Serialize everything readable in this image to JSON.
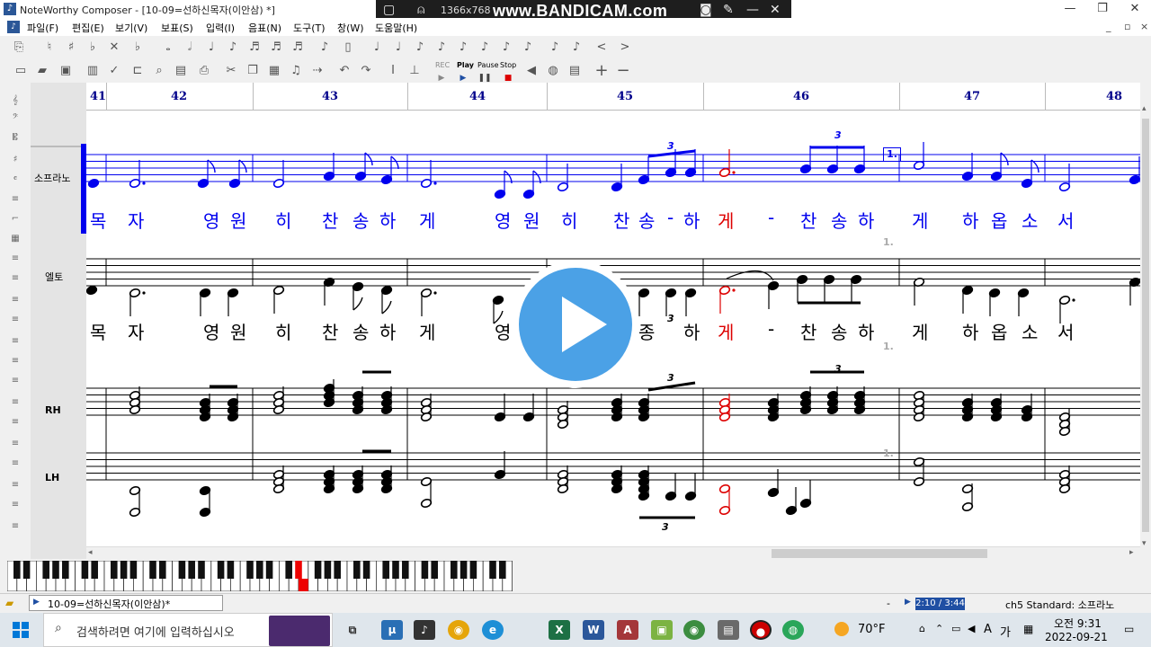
{
  "window": {
    "title": "NoteWorthy Composer - [10-09=선하신목자(이안삼) *]",
    "minimize": "—",
    "restore": "❐",
    "close": "✕",
    "mdi_min": "_",
    "mdi_restore": "▫",
    "mdi_close": "×"
  },
  "overlay": {
    "recording_size": "1366x768",
    "brand": "www.BANDICAM.com"
  },
  "menu": [
    "파일(F)",
    "편집(E)",
    "보기(V)",
    "보표(S)",
    "입력(I)",
    "음표(N)",
    "도구(T)",
    "창(W)",
    "도움말(H)"
  ],
  "toolbar2": {
    "play": "Play",
    "pause": "Pause",
    "stop": "Stop",
    "rec": "REC"
  },
  "score": {
    "measures": [
      "41",
      "42",
      "43",
      "44",
      "45",
      "46",
      "47",
      "48"
    ],
    "ending_mark": "1.",
    "tuplet": "3",
    "staves": {
      "soprano": "소프라노",
      "alto": "엘토",
      "rh": "RH",
      "lh": "LH"
    },
    "soprano_lyrics": [
      "목",
      "자",
      "영",
      "원",
      "히",
      "찬",
      "송",
      "하",
      "게",
      "영",
      "원",
      "히",
      "찬",
      "송",
      "-",
      "하",
      "게",
      "-",
      "찬",
      "송",
      "하",
      "게",
      "하",
      "옵",
      "소",
      "서"
    ],
    "alto_lyrics": [
      "목",
      "자",
      "영",
      "원",
      "히",
      "찬",
      "송",
      "하",
      "게",
      "영",
      "종",
      "하",
      "게",
      "-",
      "찬",
      "송",
      "하",
      "게",
      "하",
      "옵",
      "소",
      "서"
    ]
  },
  "status": {
    "tab_label": "10-09=선하신목자(이안삼)*",
    "dash": "-",
    "time": "2:10 / 3:44",
    "channel": "ch5 Standard: 소프라노"
  },
  "taskbar": {
    "search_placeholder": "검색하려면 여기에 입력하십시오",
    "weather": "70°F",
    "ime_a": "A",
    "ime_ga": "가",
    "clock_time": "오전 9:31",
    "clock_date": "2022-09-21"
  },
  "colors": {
    "selected_staff": "#0000ee",
    "current_note": "#dd0000",
    "measure_numbers": "#00008b",
    "play_overlay": "#4ba1e6",
    "progress": "#1f4fa3"
  }
}
